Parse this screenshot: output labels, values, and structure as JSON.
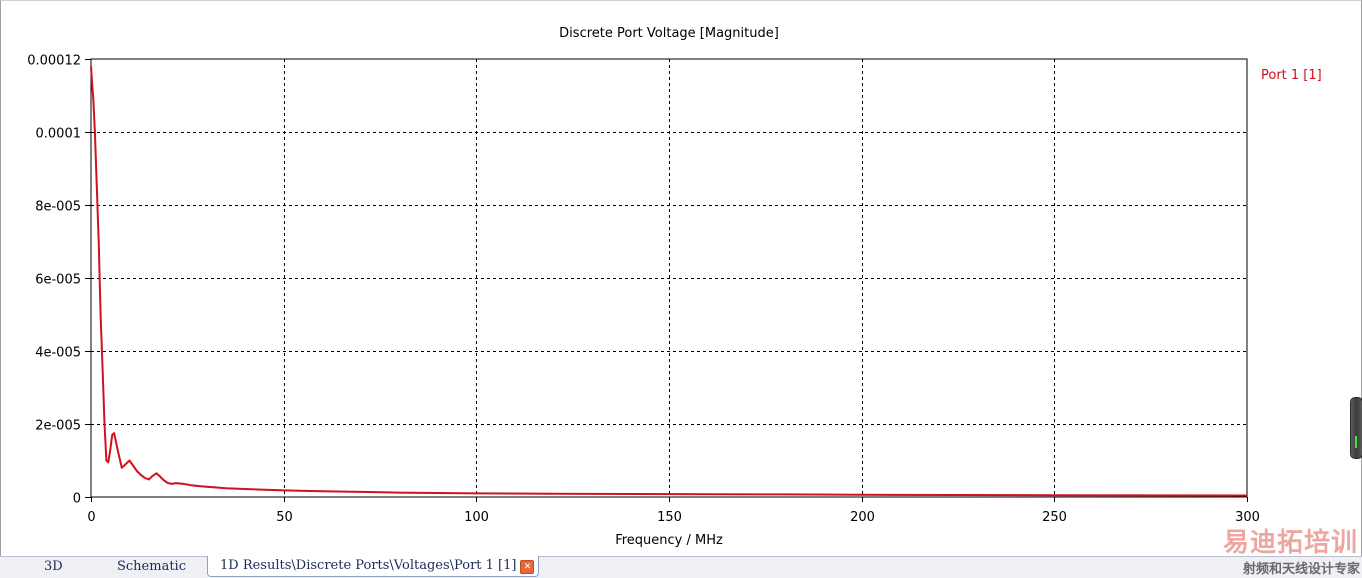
{
  "chart_data": {
    "type": "line",
    "title": "Discrete Port Voltage [Magnitude]",
    "xlabel": "Frequency / MHz",
    "ylabel": "",
    "xlim": [
      0,
      300
    ],
    "ylim": [
      0,
      0.00012
    ],
    "x_ticks": [
      0,
      50,
      100,
      150,
      200,
      250,
      300
    ],
    "x_tick_labels": [
      "0",
      "50",
      "100",
      "150",
      "200",
      "250",
      "300"
    ],
    "y_ticks": [
      0,
      2e-05,
      4e-05,
      6e-05,
      8e-05,
      0.0001,
      0.00012
    ],
    "y_tick_labels": [
      "0",
      "2e-005",
      "4e-005",
      "6e-005",
      "8e-005",
      "0.0001",
      "0.00012"
    ],
    "grid": true,
    "legend_position": "right",
    "series": [
      {
        "name": "Port 1 [1]",
        "color": "#d0101c",
        "x": [
          0,
          0.3,
          0.6,
          1.0,
          1.5,
          2.0,
          2.5,
          3.0,
          3.5,
          4.0,
          4.5,
          5.0,
          5.5,
          6.0,
          7.0,
          8.0,
          9.0,
          10.0,
          11.0,
          12.0,
          13.0,
          14.0,
          15.0,
          16.0,
          17.0,
          18.0,
          19.0,
          20.0,
          21.0,
          22.0,
          24.0,
          26.0,
          28.0,
          30.0,
          35.0,
          40.0,
          50.0,
          60.0,
          70.0,
          80.0,
          90.0,
          100.0,
          120.0,
          150.0,
          180.0,
          200.0,
          250.0,
          300.0
        ],
        "y": [
          0.000118,
          0.000113,
          0.000109,
          0.0001,
          8.5e-05,
          7e-05,
          5e-05,
          3.5e-05,
          2e-05,
          1e-05,
          9.5e-06,
          1.3e-05,
          1.7e-05,
          1.75e-05,
          1.25e-05,
          8e-06,
          9e-06,
          1e-05,
          8.5e-06,
          7e-06,
          6e-06,
          5.2e-06,
          4.8e-06,
          5.8e-06,
          6.5e-06,
          5.5e-06,
          4.5e-06,
          3.8e-06,
          3.6e-06,
          3.8e-06,
          3.6e-06,
          3.2e-06,
          3e-06,
          2.8e-06,
          2.4e-06,
          2.2e-06,
          1.8e-06,
          1.6e-06,
          1.4e-06,
          1.2e-06,
          1.1e-06,
          1e-06,
          9e-07,
          8e-07,
          7e-07,
          6e-07,
          5e-07,
          4e-07
        ]
      }
    ]
  },
  "tabs": [
    {
      "label": "3D"
    },
    {
      "label": "Schematic"
    },
    {
      "label": "1D Results\\Discrete Ports\\Voltages\\Port 1 [1]",
      "active": true
    }
  ],
  "watermark": {
    "title": "易迪拓培训",
    "subtitle": "射频和天线设计专家"
  },
  "colors": {
    "series": "#d0101c",
    "grid": "#000000",
    "legend_text": "#d0101c"
  }
}
